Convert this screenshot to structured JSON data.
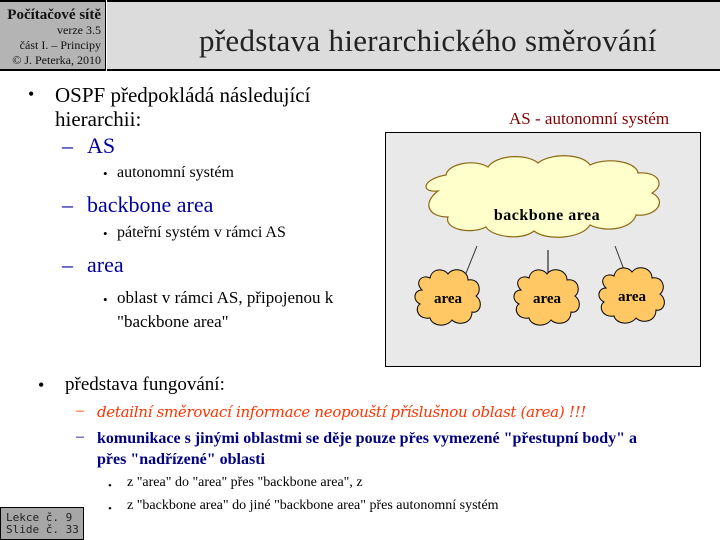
{
  "header": {
    "course": "Počítačové sítě",
    "version": "verze 3.5",
    "part": "část I.  – Principy",
    "author": "© J. Peterka, 2010",
    "title": "představa hierarchického směrování"
  },
  "main": {
    "intro_line1": "OSPF předpokládá  následující",
    "intro_line2": "hierarchii:",
    "items": [
      {
        "term": "AS",
        "desc": "autonomní systém"
      },
      {
        "term": "backbone area",
        "desc": "páteřní systém v rámci AS"
      },
      {
        "term": "area",
        "desc_line1": "oblast v rámci AS, připojenou k",
        "desc_line2": "\"backbone area\""
      }
    ],
    "bullet": "•",
    "dash": "–"
  },
  "diagram": {
    "caption": "AS - autonomní systém",
    "backbone_label": "backbone area",
    "area_labels": [
      "area",
      "area",
      "area"
    ],
    "colors": {
      "box_bg": "#e9e9e9",
      "backbone_fill": "#ffffcc",
      "backbone_stroke": "#8b6914",
      "area_fill": "#ffc864",
      "area_stroke": "#000000"
    }
  },
  "lower": {
    "title": "představa fungování:",
    "red_item": "detailní směrovací informace neopouští příslušnou oblast (area) !!!",
    "blue_item_line1": "komunikace s jinými oblastmi se děje pouze přes vymezené \"přestupní body\" a",
    "blue_item_line2": "přes \"nadřízené\" oblasti",
    "sub_items": [
      "z \"area\"  do \"area\"  přes \"backbone area\",  z",
      "z \"backbone area\"  do jiné \"backbone area\"  přes autonomní systém"
    ]
  },
  "footer": {
    "lesson": "Lekce č. 9",
    "slide": "Slide č. 33"
  },
  "colors": {
    "blue_heading": "#000099",
    "red_italic": "#ff3300",
    "blue_bold": "#000080",
    "caption_red": "#800000"
  }
}
